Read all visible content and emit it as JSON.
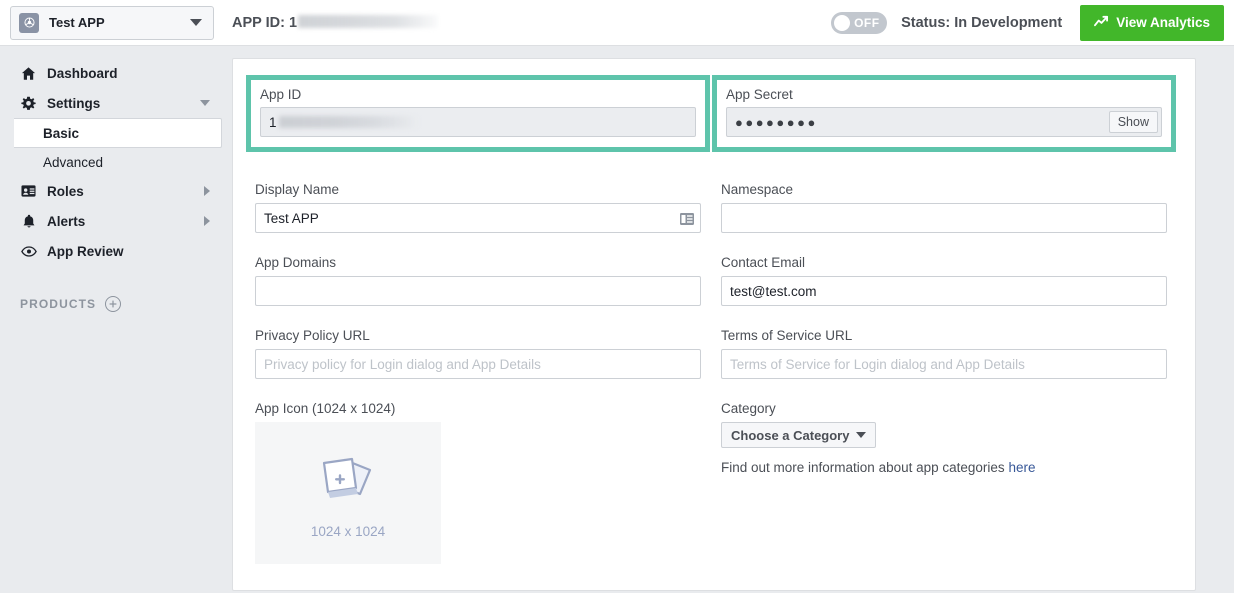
{
  "topbar": {
    "app_name": "Test APP",
    "app_icon": "atom-icon",
    "caret_icon": "chevron-down-icon",
    "appid_label": "APP ID:",
    "appid_prefix": "1",
    "toggle_state": "OFF",
    "status": "Status: In Development",
    "analytics_button": "View Analytics",
    "analytics_icon": "trending-up-icon",
    "accent_green": "#42b72a"
  },
  "sidebar": {
    "items": [
      {
        "label": "Dashboard",
        "icon": "home-icon",
        "caret": "none"
      },
      {
        "label": "Settings",
        "icon": "gear-icon",
        "caret": "down"
      },
      {
        "label": "Roles",
        "icon": "id-card-icon",
        "caret": "right"
      },
      {
        "label": "Alerts",
        "icon": "bell-icon",
        "caret": "right"
      },
      {
        "label": "App Review",
        "icon": "eye-icon",
        "caret": "none"
      }
    ],
    "settings_sub": [
      {
        "label": "Basic",
        "active": true
      },
      {
        "label": "Advanced",
        "active": false
      }
    ],
    "products_title": "PRODUCTS",
    "products_add_icon": "plus-circle-icon"
  },
  "form": {
    "highlight_color": "#5ec4ab",
    "app_id": {
      "label": "App ID",
      "value_prefix": "1",
      "redacted": true,
      "highlighted": true
    },
    "app_secret": {
      "label": "App Secret",
      "masked_value": "●●●●●●●●",
      "show_button": "Show",
      "highlighted": true
    },
    "display_name": {
      "label": "Display Name",
      "value": "Test APP",
      "icon": "card-list-icon"
    },
    "namespace": {
      "label": "Namespace",
      "value": "",
      "placeholder": ""
    },
    "app_domains": {
      "label": "App Domains",
      "value": "",
      "placeholder": ""
    },
    "contact_email": {
      "label": "Contact Email",
      "value": "test@test.com",
      "placeholder": ""
    },
    "privacy_policy_url": {
      "label": "Privacy Policy URL",
      "value": "",
      "placeholder": "Privacy policy for Login dialog and App Details"
    },
    "terms_of_service_url": {
      "label": "Terms of Service URL",
      "value": "",
      "placeholder": "Terms of Service for Login dialog and App Details"
    },
    "app_icon": {
      "label": "App Icon (1024 x 1024)",
      "caption": "1024 x 1024",
      "upload_icon": "add-photo-icon"
    },
    "category": {
      "label": "Category",
      "selected": "Choose a Category",
      "caret_icon": "chevron-down-icon",
      "help_text": "Find out more information about app categories",
      "help_link": "here"
    }
  }
}
